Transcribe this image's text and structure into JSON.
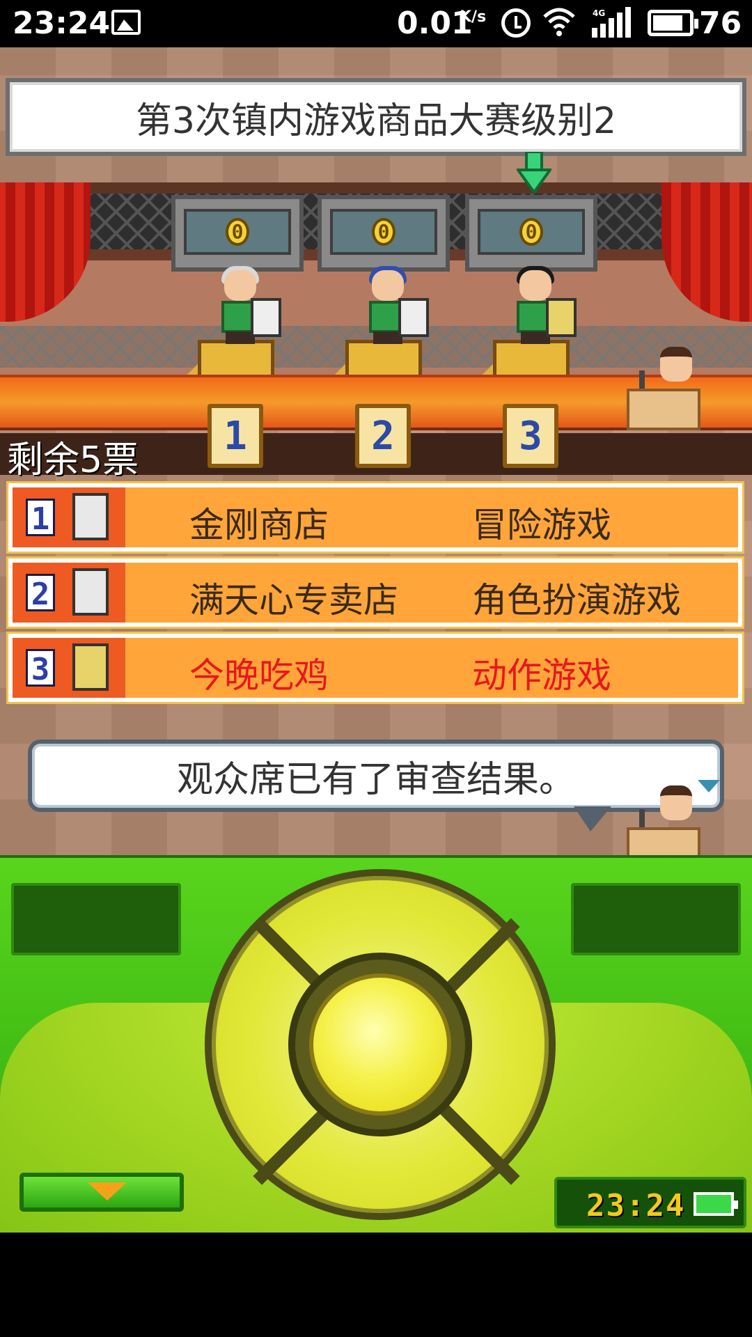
{
  "status_bar": {
    "time": "23:24",
    "network_speed": "0.01",
    "network_speed_unit": "K/s",
    "network_type": "4G",
    "battery": "76",
    "icons": [
      "image-icon",
      "alarm-icon",
      "wifi-icon",
      "signal-icon",
      "battery-icon"
    ]
  },
  "contest": {
    "title": "第3次镇内游戏商品大赛级别2",
    "scores": [
      "0",
      "0",
      "0"
    ],
    "selected_index": 3,
    "podium_numbers": [
      "1",
      "2",
      "3"
    ],
    "votes_left": "剩余5票"
  },
  "entries": [
    {
      "number": "1",
      "store": "金刚商店",
      "genre": "冒险游戏",
      "highlight": false
    },
    {
      "number": "2",
      "store": "满天心专卖店",
      "genre": "角色扮演游戏",
      "highlight": false
    },
    {
      "number": "3",
      "store": "今晚吃鸡",
      "genre": "动作游戏",
      "highlight": true
    }
  ],
  "dialog": {
    "message": "观众席已有了审查结果。"
  },
  "controller": {
    "clock": "23:24"
  }
}
